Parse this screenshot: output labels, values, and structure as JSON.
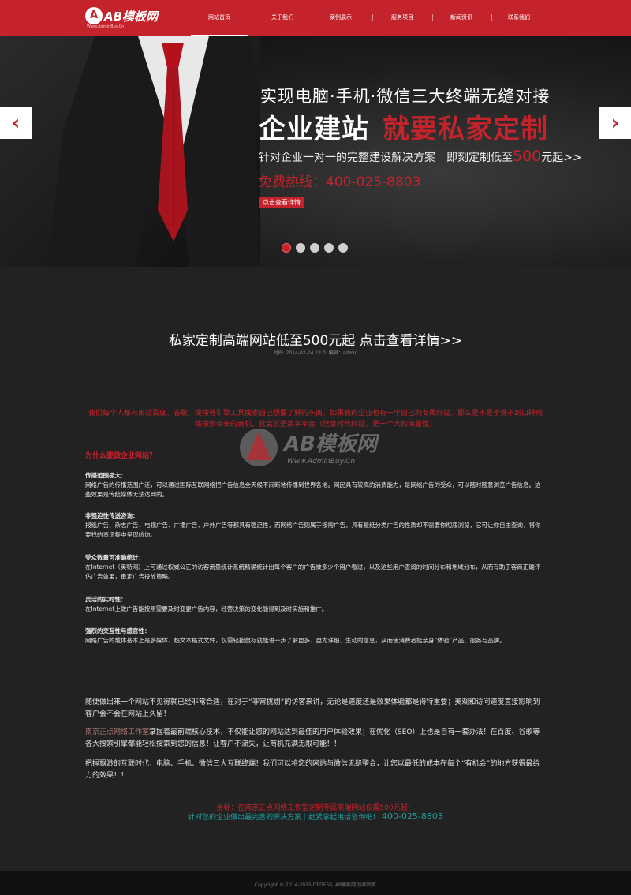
{
  "header": {
    "logo_mark": "A",
    "logo_text": "AB模板网",
    "logo_sub": "Www.AdminBuy.Cn",
    "nav": [
      "网站首页",
      "关于我们",
      "案例展示",
      "服务项目",
      "新闻资讯",
      "联系我们"
    ],
    "active_nav_index": 0,
    "separator": "|"
  },
  "banner": {
    "line1": "实现电脑·手机·微信三大终端无缝对接",
    "line2_white": "企业建站",
    "line2_red": "就要私家定制",
    "line3_pre": "针对企业一对一的完整建设解决方案　即刻定制低至",
    "line3_price": "500",
    "line3_post": "元起>>",
    "hotline": "免费热线：400-025-8803",
    "button": "点击查看详情",
    "prev_arrow": "‹",
    "next_arrow": "›",
    "slide_count": 5,
    "active_slide": 0
  },
  "article": {
    "title": "私家定制高端网站低至500元起 点击查看详情>>",
    "meta": "时间: 2014-02-24 22:01编辑：admin",
    "intro": "我们每个人都有用过百度、谷歌、搜搜等引擎工具搜索自己想要了解的东西，如果我的企业也有一个自己的专属网站，那么是不是享受不到口碑网络搜索带来的商机，就会就是数字平台（信息时代网站，是一个大的海量性）",
    "why_heading": "为什么要做企业网站？",
    "sections": [
      {
        "heading": "传播范围极大：",
        "body": "网络广告的传播范围广泛，可以通过国际互联网络把广告信息全天候不间断地传播到世界各地。网民具有较高的消费能力，是网络广告的受众，可以随时随意浏览广告信息。这些效果是传统媒体无法达到的。"
      },
      {
        "heading": "非强迫性传送咨询：",
        "body": "报纸广告、杂志广告、电视广告、广播广告、户外广告等都具有强迫性，而网络广告则属于按需广告，具有报纸分类广告的性质却不需要你彻底浏览，它可让你自由查询，将你要找的资讯集中呈现给你。"
      },
      {
        "heading": "受众数量可准确统计：",
        "body": "在Internet（英特网）上可通过权威公正的访客流量统计系统精确统计出每个客户的广告被多少个用户看过，以及这些用户查阅的时间分布和地域分布，从而有助于客商正确评估广告效果，审定广告投放策略。"
      },
      {
        "heading": "灵活的实时性：",
        "body": "在Internet上做广告能按照需要及时变更广告内容，经营决策的变化能得到及时实施和推广。"
      },
      {
        "heading": "强烈的交互性与感官性：",
        "body": "网络广告的载体基本上是多媒体、超文本格式文件，仅需轻按鼠标就能进一步了解更多、更为详细、生动的信息，从而使消费者能亲身“体验”产品、服务与品牌。"
      }
    ],
    "para1": "随便做出来一个网站不见得就已经非常合适，在对于“非常挑剔”的访客来讲，无论是速度还是效果体验都是得特重要；美观和访问速度直接影响到客户会不会在网站上久留！",
    "para2_pink": "南京正点网络工作室",
    "para2_rest": "掌握着最前端核心技术，不仅能让您的网站达到最佳的用户体验效果；在优化（SEO）上也是自有一套办法！在百度、谷歌等各大搜索引擎都能轻松搜索到您的信息！让客户不流失，让商机充满无限可能！！",
    "para3": "把握飘渺的互联时代，电脑、手机、微信三大互联终端！我们可以将您的网站与微信无缝整合，让您以最低的成本在每个“有机会”的地方获得最给力的效果！！",
    "cta1": "坐标：在南京正点网络工作室定制专属高端网站仅需500元起！",
    "cta2_text": "针对您的企业做出最完善的解决方案｜赶紧拿起电话咨询吧！",
    "cta2_tel": "400-025-8803"
  },
  "watermark": {
    "text": "AB模板网",
    "sub": "Www.AdminBuy.Cn"
  },
  "footer": {
    "copyright": "Copyright © 2014-2015 DEDE58, AB模板网 版权所有"
  },
  "colors": {
    "brand_red": "#c4232b",
    "background": "#222222",
    "teal": "#1fa0a0"
  }
}
